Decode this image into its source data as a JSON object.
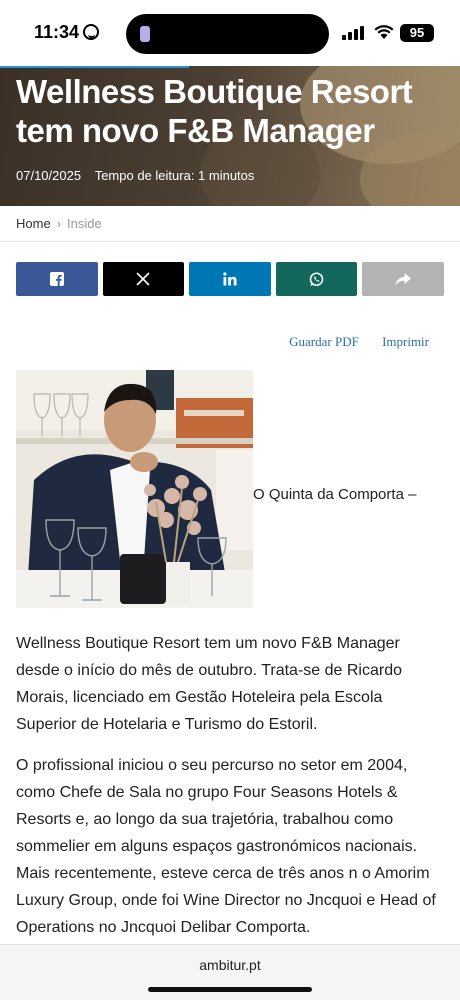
{
  "status_bar": {
    "time": "11:34",
    "battery": "95"
  },
  "hero": {
    "title": "Wellness Boutique Resort tem novo F&B Manager",
    "date": "07/10/2025",
    "reading_time": "Tempo de leitura: 1 minutos",
    "progress_percent": 41
  },
  "breadcrumb": {
    "home": "Home",
    "separator": "›",
    "current": "Inside"
  },
  "share": {
    "buttons": [
      {
        "name": "facebook",
        "icon": "facebook-icon",
        "color": "#3b5998"
      },
      {
        "name": "x",
        "icon": "x-icon",
        "color": "#000000"
      },
      {
        "name": "linkedin",
        "icon": "linkedin-icon",
        "color": "#0077b5"
      },
      {
        "name": "whatsapp",
        "icon": "whatsapp-icon",
        "color": "#12685c"
      },
      {
        "name": "share",
        "icon": "share-arrow-icon",
        "color": "#b3b3b3"
      }
    ]
  },
  "doc_links": {
    "pdf": "Guardar PDF",
    "print": "Imprimir"
  },
  "photo": {
    "caption": "O Quinta da Comporta –"
  },
  "article": {
    "paragraphs": [
      "Wellness Boutique Resort tem um novo F&B Manager desde o início do mês de outubro. Trata-se de Ricardo Morais, licenciado em Gestão Hoteleira pela Escola Superior de Hotelaria e Turismo do Estoril.",
      "O profissional iniciou o seu percurso no setor em 2004, como Chefe de Sala no grupo Four Seasons Hotels & Resorts e, ao longo da sua trajetória, trabalhou como sommelier em alguns espaços gastronómicos nacionais. Mais recentemente, esteve cerca de três anos n o Amorim Luxury Group, onde foi Wine Director no Jncquoi e Head of Operations no Jncquoi Delibar Comporta."
    ]
  },
  "browser": {
    "url": "ambitur.pt"
  }
}
